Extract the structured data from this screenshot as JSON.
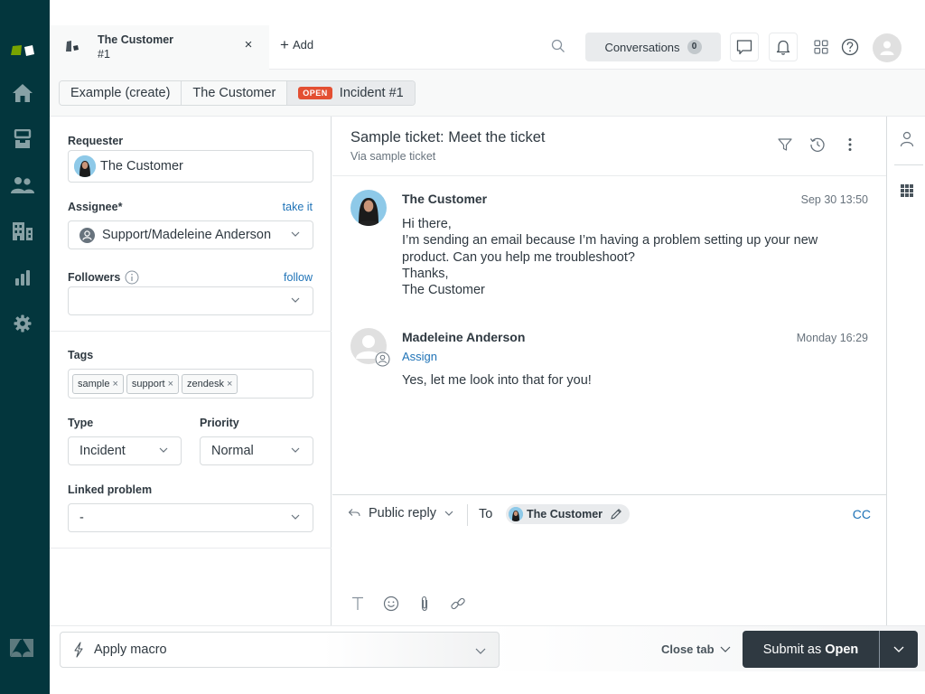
{
  "nav": {
    "items": [
      {
        "name": "home",
        "icon": "home-icon"
      },
      {
        "name": "views",
        "icon": "views-icon"
      },
      {
        "name": "customers",
        "icon": "users-icon"
      },
      {
        "name": "organizations",
        "icon": "building-icon"
      },
      {
        "name": "reporting",
        "icon": "bar-chart-icon"
      },
      {
        "name": "admin",
        "icon": "gear-icon"
      }
    ],
    "brand_colors": {
      "green": "#78a300",
      "bg": "#03363d"
    }
  },
  "topbar": {
    "tab": {
      "title": "The Customer",
      "subtitle": "#1"
    },
    "add_label": "Add",
    "conversations_label": "Conversations",
    "conversations_count": "0"
  },
  "breadcrumbs": [
    {
      "label": "Example (create)"
    },
    {
      "label": "The Customer"
    },
    {
      "label": "Incident #1",
      "status": "OPEN"
    }
  ],
  "properties": {
    "requester": {
      "label": "Requester",
      "value": "The Customer"
    },
    "assignee": {
      "label": "Assignee*",
      "link": "take it",
      "value": "Support/Madeleine Anderson"
    },
    "followers": {
      "label": "Followers",
      "link": "follow",
      "value": ""
    },
    "tags": {
      "label": "Tags",
      "items": [
        "sample",
        "support",
        "zendesk"
      ],
      "remove_glyph": "×"
    },
    "type": {
      "label": "Type",
      "value": "Incident"
    },
    "priority": {
      "label": "Priority",
      "value": "Normal"
    },
    "linked_problem": {
      "label": "Linked problem",
      "value": "-"
    }
  },
  "ticket": {
    "title": "Sample ticket: Meet the ticket",
    "via": "Via sample ticket",
    "messages": [
      {
        "author": "The Customer",
        "time": "Sep 30 13:50",
        "body": "Hi there,\nI’m sending an email because I’m having a problem setting up your new product. Can you help me troubleshoot?\nThanks,\nThe Customer"
      },
      {
        "author": "Madeleine Anderson",
        "time": "Monday 16:29",
        "action": "Assign",
        "body": "Yes, let me look into that for you!"
      }
    ]
  },
  "composer": {
    "reply_type": "Public reply",
    "to_label": "To",
    "recipient": "The Customer",
    "cc_label": "CC"
  },
  "footer": {
    "macro_label": "Apply macro",
    "close_tab_label": "Close tab",
    "submit_prefix": "Submit as",
    "submit_status": "Open"
  },
  "colors": {
    "link": "#1f73b7",
    "open_status": "#e34f32",
    "submit_bg": "#2f3941"
  }
}
